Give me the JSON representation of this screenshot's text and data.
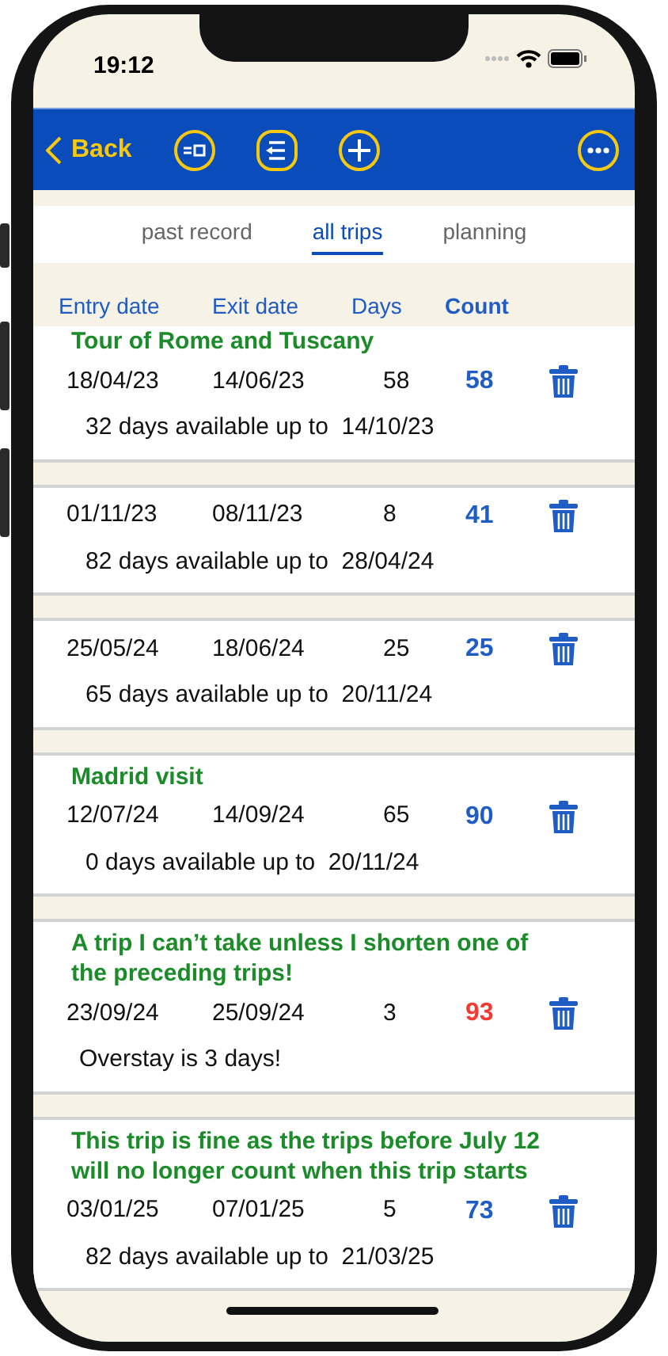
{
  "status_bar": {
    "time": "19:12"
  },
  "nav_bar": {
    "back": "Back",
    "actions": [
      {
        "kind": "list"
      },
      {
        "kind": "outdent"
      },
      {
        "kind": "add"
      }
    ],
    "more": {
      "kind": "more"
    }
  },
  "tabs": [
    {
      "label": "past record",
      "selected": false
    },
    {
      "label": "all trips",
      "selected": true
    },
    {
      "label": "planning",
      "selected": false
    }
  ],
  "columns": [
    {
      "label": "Entry date",
      "bold": false
    },
    {
      "label": "Exit date",
      "bold": false
    },
    {
      "label": "Days",
      "bold": false
    },
    {
      "label": "Count",
      "bold": true
    }
  ],
  "trips": [
    {
      "title": "Tour of Rome and Tuscany",
      "entry": "18/04/23",
      "exit": "14/06/23",
      "days": "58",
      "count": "58",
      "overstay": false,
      "note": "32 days available up to  14/10/23"
    },
    {
      "entry": "01/11/23",
      "exit": "08/11/23",
      "days": "8",
      "count": "41",
      "overstay": false,
      "note": "82 days available up to  28/04/24"
    },
    {
      "entry": "25/05/24",
      "exit": "18/06/24",
      "days": "25",
      "count": "25",
      "overstay": false,
      "note": "65 days available up to  20/11/24"
    },
    {
      "title": "Madrid visit",
      "entry": "12/07/24",
      "exit": "14/09/24",
      "days": "65",
      "count": "90",
      "overstay": false,
      "note": "0 days available up to  20/11/24"
    },
    {
      "title": "A trip I can’t take unless I shorten one of the preceding trips!",
      "entry": "23/09/24",
      "exit": "25/09/24",
      "days": "3",
      "count": "93",
      "overstay": true,
      "note": "Overstay is 3 days!"
    },
    {
      "title": "This trip is fine as the trips before July 12 will no longer count when this trip starts",
      "entry": "03/01/25",
      "exit": "07/01/25",
      "days": "5",
      "count": "73",
      "overstay": false,
      "note": "82 days available up to  21/03/25"
    }
  ]
}
